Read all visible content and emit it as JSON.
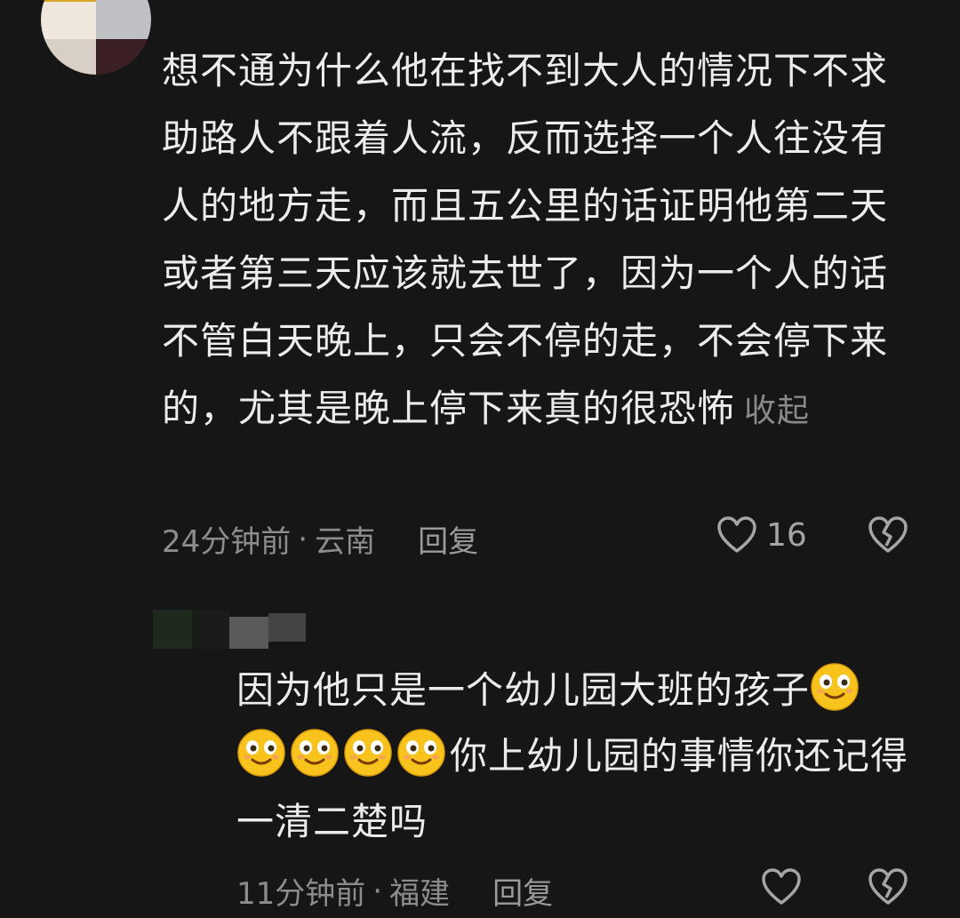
{
  "comment": {
    "text": "想不通为什么他在找不到大人的情况下不求助路人不跟着人流，反而选择一个人往没有人的地方走，而且五公里的话证明他第二天或者第三天应该就去世了，因为一个人的话不管白天晚上，只会不停的走，不会停下来的，尤其是晚上停下来真的很恐怖",
    "collapse_label": "收起",
    "time": "24分钟前",
    "separator": "·",
    "location": "云南",
    "reply_label": "回复",
    "like_count": "16"
  },
  "reply": {
    "text_part1": "因为他只是一个幼儿园大班的孩子",
    "text_part2": "你上幼儿园的事情你还记得一清二楚吗",
    "emoji_name": "smiley-emoji",
    "time": "11分钟前",
    "separator": "·",
    "location": "福建",
    "reply_label": "回复"
  },
  "colors": {
    "background": "#161616",
    "text": "#ececec",
    "muted": "#8c8c8c",
    "emoji_face": "#f7c31c"
  }
}
